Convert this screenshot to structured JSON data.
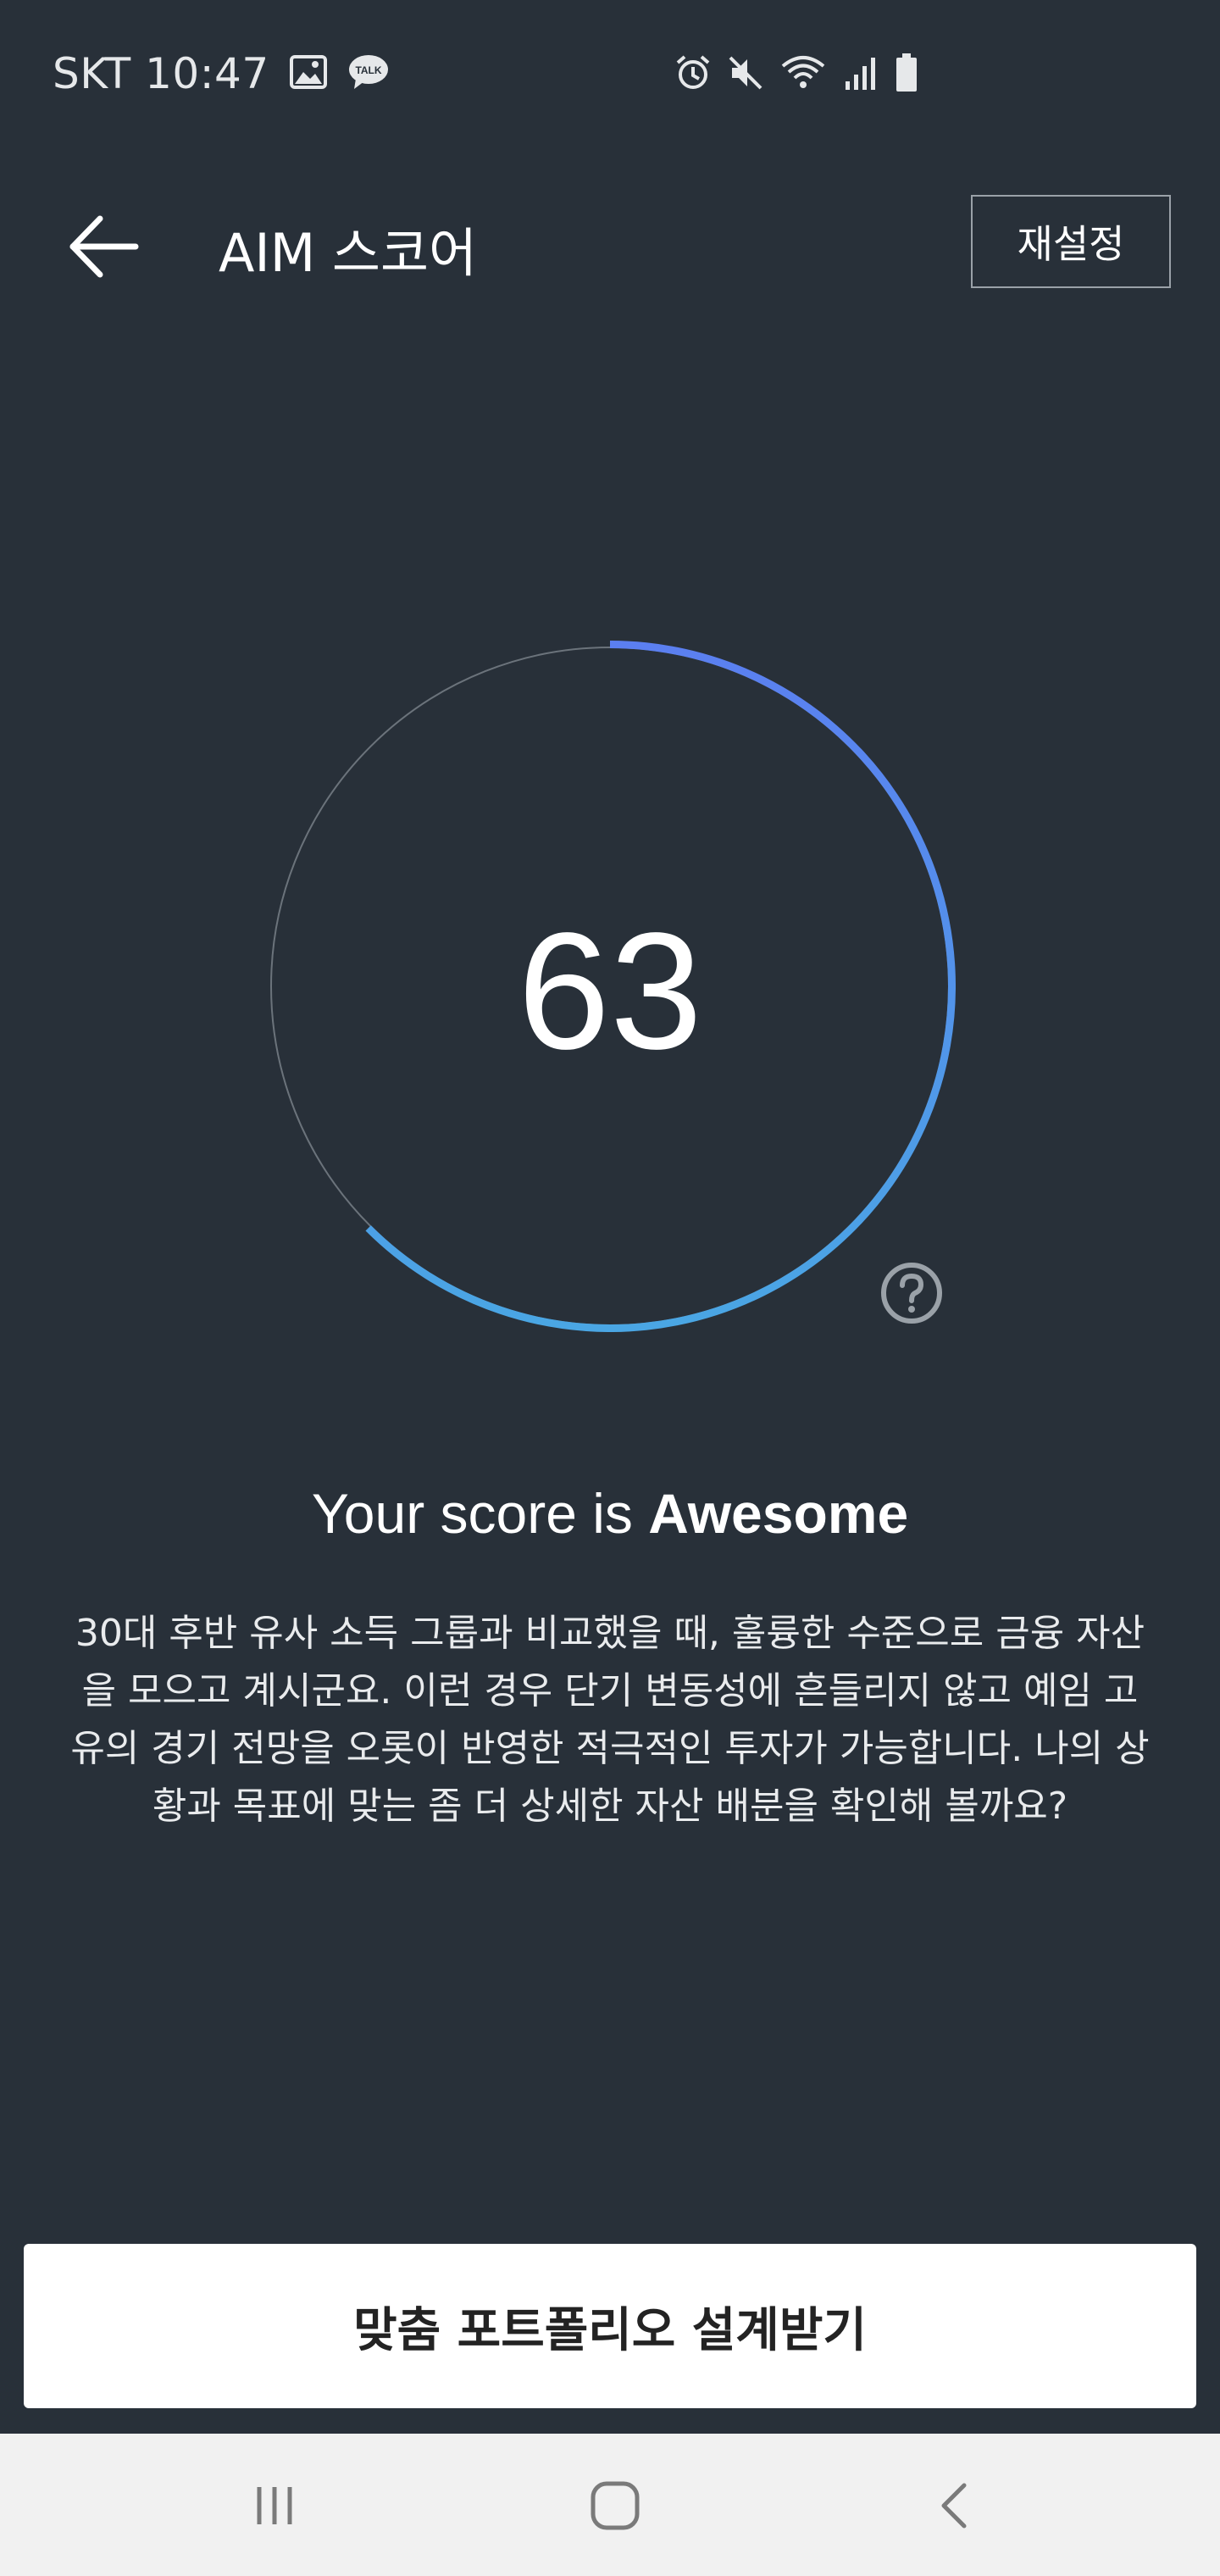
{
  "status_bar": {
    "carrier_time": "SKT 10:47",
    "icons": [
      "image-icon",
      "talk-icon",
      "alarm-icon",
      "mute-icon",
      "wifi-icon",
      "signal-icon",
      "battery-icon"
    ],
    "talk_text": "TALK"
  },
  "app_bar": {
    "title": "AIM 스코어",
    "reset_label": "재설정"
  },
  "score": {
    "value": "63",
    "ring_fraction": 0.625,
    "ring_colors": [
      "#5b7ff0",
      "#4aa6e4"
    ],
    "track_color": "#6b737b"
  },
  "result": {
    "prefix": "Your score is ",
    "grade": "Awesome",
    "description": "30대 후반 유사 소득 그룹과 비교했을 때, 훌륭한 수준으로 금융 자산을 모으고 계시군요. 이런 경우 단기 변동성에 흔들리지 않고 예임 고유의 경기 전망을 오롯이 반영한 적극적인 투자가 가능합니다. 나의 상황과 목표에 맞는 좀 더 상세한 자산 배분을 확인해 볼까요?"
  },
  "cta": {
    "label": "맞춤 포트폴리오 설계받기"
  },
  "nav_bar": {
    "icons": [
      "recent-apps-icon",
      "home-icon",
      "back-nav-icon"
    ]
  }
}
